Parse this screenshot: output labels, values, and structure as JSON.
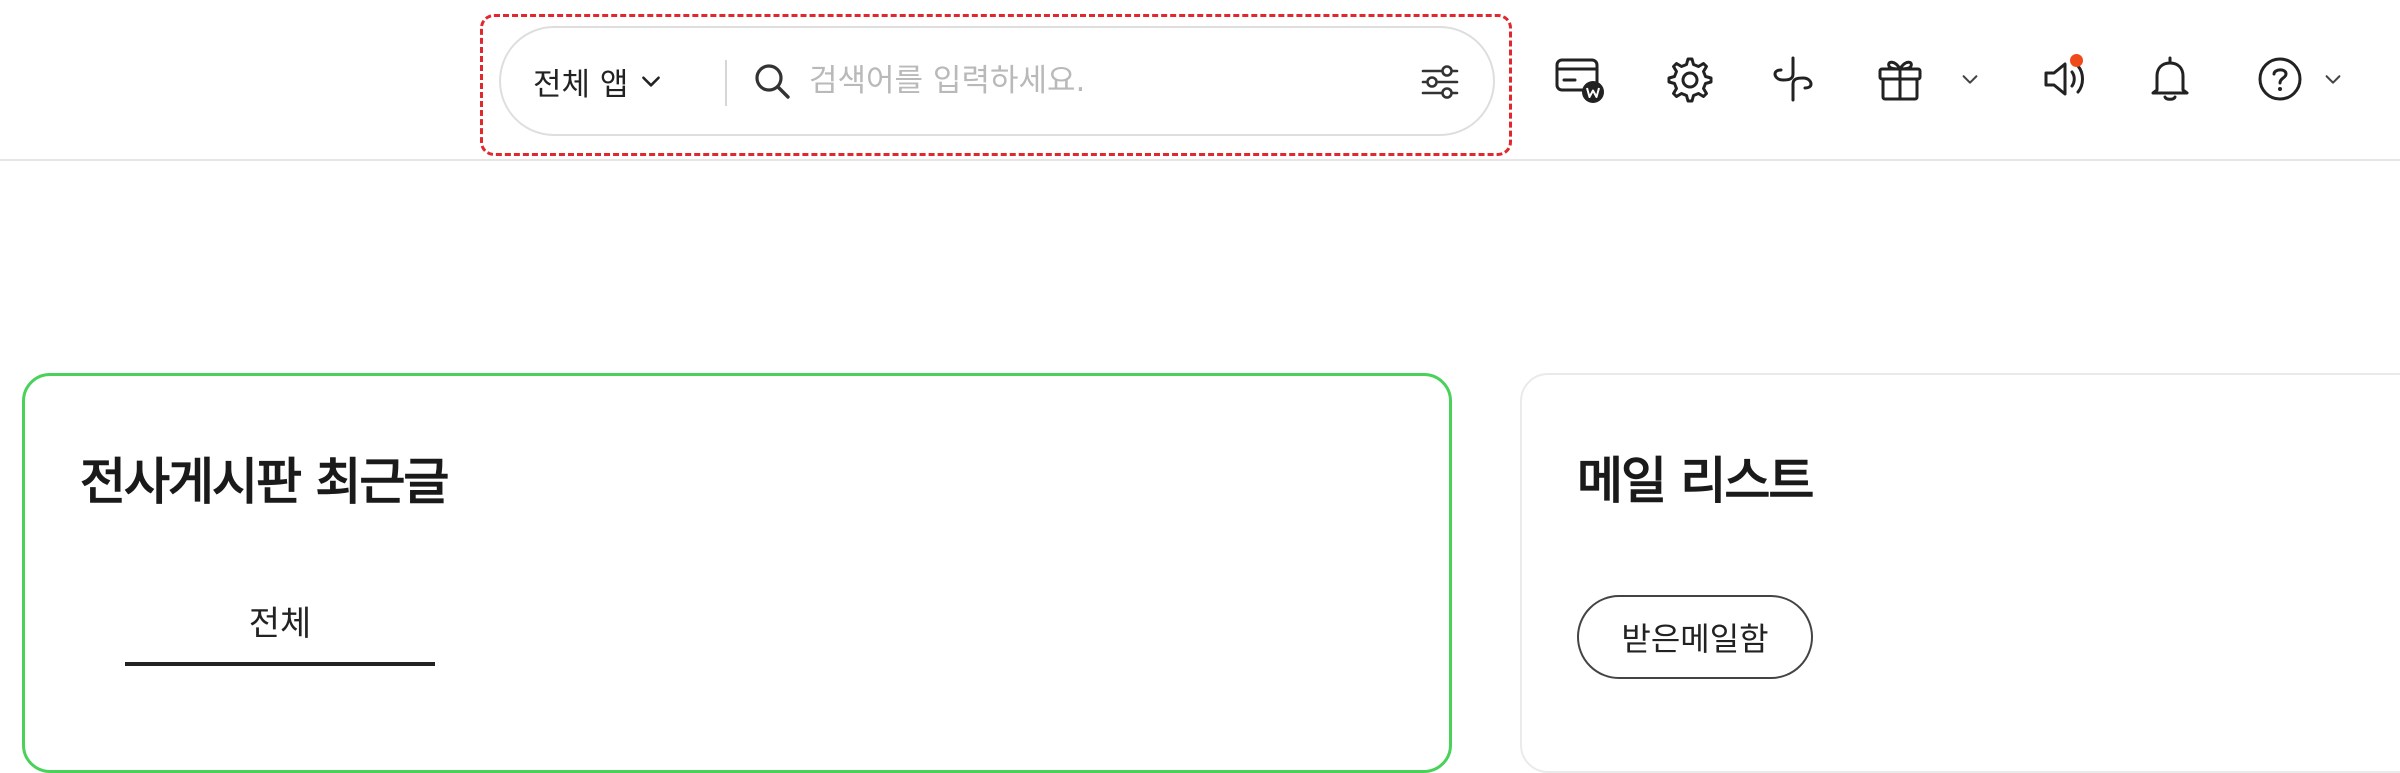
{
  "search": {
    "scope_label": "전체 앱",
    "placeholder": "검색어를 입력하세요.",
    "value": ""
  },
  "toolbar": {
    "icons": [
      "wallet-w-icon",
      "gear-icon",
      "connector-icon",
      "gift-icon",
      "speaker-icon",
      "bell-icon",
      "help-icon"
    ],
    "notification_dot_color": "#f04a1a"
  },
  "board_card": {
    "title": "전사게시판 최근글",
    "tabs": [
      {
        "label": "전체",
        "active": true
      }
    ]
  },
  "mail_card": {
    "title": "메일 리스트",
    "filter_label": "받은메일함"
  },
  "colors": {
    "accent_green": "#4ad15a",
    "highlight_red": "#e0282e"
  }
}
